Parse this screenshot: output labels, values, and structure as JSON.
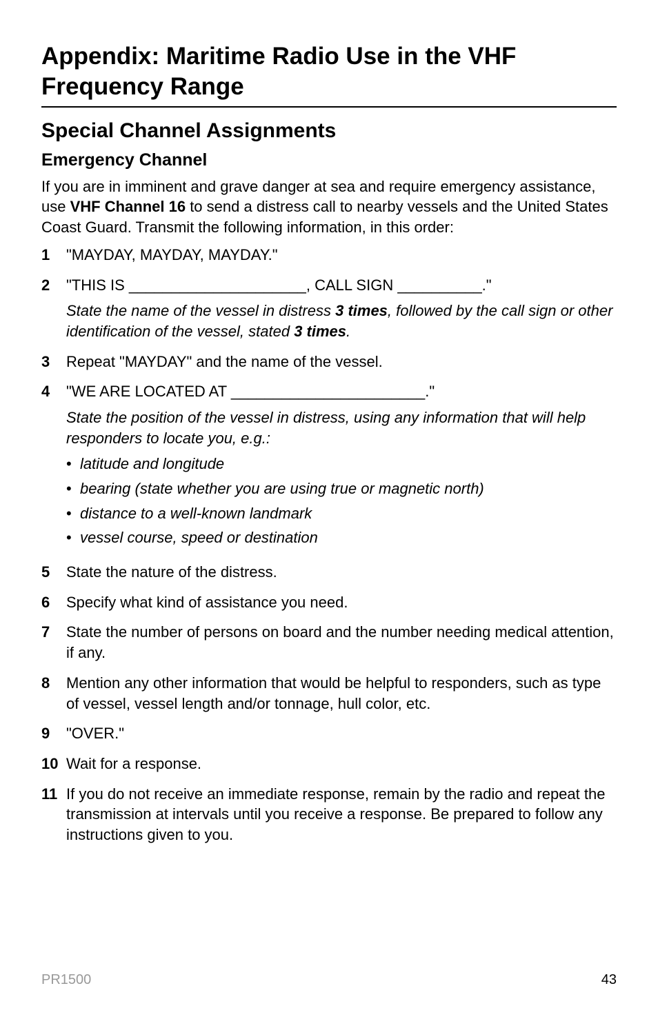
{
  "title": "Appendix: Maritime Radio Use in the VHF Frequency Range",
  "section": "Special Channel Assignments",
  "subsection": "Emergency Channel",
  "intro_pre": "If you are in imminent and grave danger at sea and require emergency assistance, use ",
  "intro_bold": "VHF Channel 16",
  "intro_post": " to send a distress call to nearby vessels and the United States Coast Guard. Transmit the following information, in this order:",
  "items": {
    "n1": "1",
    "t1": "\"MAYDAY, MAYDAY, MAYDAY.\"",
    "n2": "2",
    "t2": "\"THIS IS _____________________, CALL SIGN __________.\"",
    "t2note_a": "State the name of the vessel in distress ",
    "t2note_b": "3 times",
    "t2note_c": ", followed by the call sign or other identification of the vessel, stated ",
    "t2note_d": "3 times",
    "t2note_e": ".",
    "n3": "3",
    "t3": "Repeat \"MAYDAY\" and the name of the vessel.",
    "n4": "4",
    "t4": "\"WE ARE LOCATED AT _______________________.\"",
    "t4note": "State the position of the vessel in distress, using any information that will help responders to locate you, e.g.:",
    "b1": "latitude and longitude",
    "b2": "bearing (state whether you are using true or magnetic north)",
    "b3": "distance to a well-known landmark",
    "b4": "vessel course, speed or destination",
    "n5": "5",
    "t5": "State the nature of the distress.",
    "n6": "6",
    "t6": "Specify what kind of assistance you need.",
    "n7": "7",
    "t7": "State the number of persons on board and the number needing medical attention, if any.",
    "n8": "8",
    "t8": "Mention any other information that would be helpful to responders, such as type of vessel, vessel length and/or tonnage, hull color, etc.",
    "n9": "9",
    "t9": "\"OVER.\"",
    "n10": "10",
    "t10": "Wait for a response.",
    "n11": "11",
    "t11": "If you do not receive an immediate response, remain by the radio and repeat the transmission at intervals until you receive a response. Be prepared to follow any instructions given to you."
  },
  "footer": {
    "left": "PR1500",
    "right": "43"
  }
}
